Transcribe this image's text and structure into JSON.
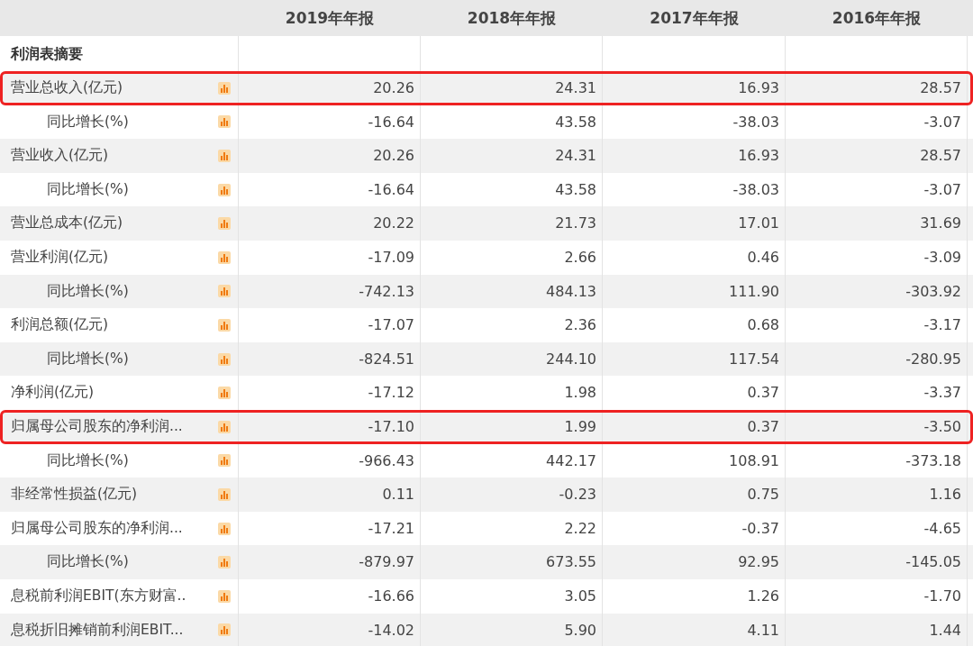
{
  "table": {
    "columns": [
      "2019年年报",
      "2018年年报",
      "2017年年报",
      "2016年年报"
    ],
    "section": "利润表摘要",
    "rows": [
      {
        "label": "营业总收入(亿元)",
        "values": [
          "20.26",
          "24.31",
          "16.93",
          "28.57"
        ],
        "highlighted": true,
        "children": [
          {
            "label": "同比增长(%)",
            "values": [
              "-16.64",
              "43.58",
              "-38.03",
              "-3.07"
            ],
            "highlighted": false
          }
        ]
      },
      {
        "label": "营业收入(亿元)",
        "values": [
          "20.26",
          "24.31",
          "16.93",
          "28.57"
        ],
        "highlighted": false,
        "children": [
          {
            "label": "同比增长(%)",
            "values": [
              "-16.64",
              "43.58",
              "-38.03",
              "-3.07"
            ],
            "highlighted": false
          }
        ]
      },
      {
        "label": "营业总成本(亿元)",
        "values": [
          "20.22",
          "21.73",
          "17.01",
          "31.69"
        ],
        "highlighted": false
      },
      {
        "label": "营业利润(亿元)",
        "values": [
          "-17.09",
          "2.66",
          "0.46",
          "-3.09"
        ],
        "highlighted": false,
        "children": [
          {
            "label": "同比增长(%)",
            "values": [
              "-742.13",
              "484.13",
              "111.90",
              "-303.92"
            ],
            "highlighted": false
          }
        ]
      },
      {
        "label": "利润总额(亿元)",
        "values": [
          "-17.07",
          "2.36",
          "0.68",
          "-3.17"
        ],
        "highlighted": false,
        "children": [
          {
            "label": "同比增长(%)",
            "values": [
              "-824.51",
              "244.10",
              "117.54",
              "-280.95"
            ],
            "highlighted": false
          }
        ]
      },
      {
        "label": "净利润(亿元)",
        "values": [
          "-17.12",
          "1.98",
          "0.37",
          "-3.37"
        ],
        "highlighted": false
      },
      {
        "label": "归属母公司股东的净利润...",
        "values": [
          "-17.10",
          "1.99",
          "0.37",
          "-3.50"
        ],
        "highlighted": true,
        "children": [
          {
            "label": "同比增长(%)",
            "values": [
              "-966.43",
              "442.17",
              "108.91",
              "-373.18"
            ],
            "highlighted": false
          }
        ]
      },
      {
        "label": "非经常性损益(亿元)",
        "values": [
          "0.11",
          "-0.23",
          "0.75",
          "1.16"
        ],
        "highlighted": false
      },
      {
        "label": "归属母公司股东的净利润...",
        "values": [
          "-17.21",
          "2.22",
          "-0.37",
          "-4.65"
        ],
        "highlighted": false,
        "children": [
          {
            "label": "同比增长(%)",
            "values": [
              "-879.97",
              "673.55",
              "92.95",
              "-145.05"
            ],
            "highlighted": false
          }
        ]
      },
      {
        "label": "息税前利润EBIT(东方财富..",
        "values": [
          "-16.66",
          "3.05",
          "1.26",
          "-1.70"
        ],
        "highlighted": false
      },
      {
        "label": "息税折旧摊销前利润EBIT...",
        "values": [
          "-14.02",
          "5.90",
          "4.11",
          "1.44"
        ],
        "highlighted": false
      }
    ]
  }
}
